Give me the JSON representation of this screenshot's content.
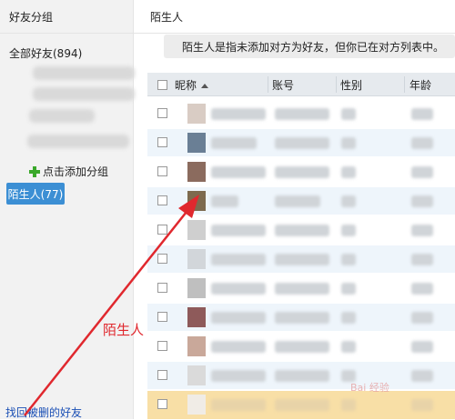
{
  "sidebar": {
    "title": "好友分组",
    "all_friends": "全部好友(894)",
    "add_group": "点击添加分组",
    "strangers": "陌生人(77)",
    "recover": "找回被删的好友"
  },
  "main": {
    "title": "陌生人",
    "info": "陌生人是指未添加对方为好友，但你已在对方列表中。"
  },
  "table": {
    "columns": [
      "昵称",
      "账号",
      "性别",
      "年龄"
    ]
  },
  "annotation": "陌生人",
  "watermark": "Bai 经验",
  "colors": {
    "accent": "#3c8fd4",
    "arrow": "#e0282e",
    "selected_row": "#f8dfa6",
    "striped_row": "#eef5fb"
  }
}
